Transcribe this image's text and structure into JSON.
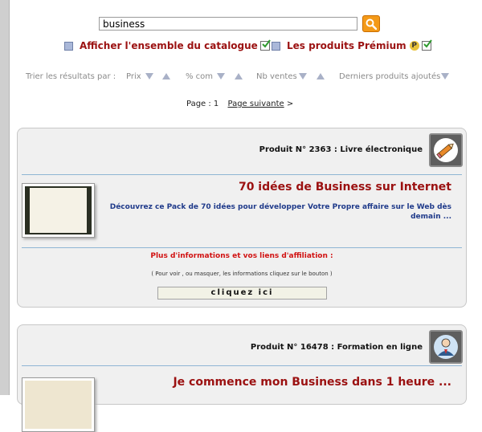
{
  "search": {
    "value": "business"
  },
  "filters": {
    "catalogue_label": "Afficher l'ensemble du catalogue",
    "premium_label": "Les produits Prémium",
    "premium_badge": "P"
  },
  "sort": {
    "label": "Trier les résultats par :",
    "options": [
      "Prix",
      "% com",
      "Nb ventes",
      "Derniers produits ajoutés"
    ]
  },
  "pager": {
    "page_label": "Page : 1",
    "next_label": "Page suivante",
    "next_arrow": ">"
  },
  "products": [
    {
      "header": "Produit N° 2363 : Livre électronique",
      "type_icon": "pencil-icon",
      "title": "70 idées de Business sur Internet",
      "description": "Découvrez ce Pack de 70 idées pour développer Votre Propre affaire sur le Web dès demain ...",
      "more_info": "Plus d'informations et vos liens d'affiliation :",
      "hint": "( Pour voir , ou masquer, les informations cliquez sur le bouton )",
      "button": "cliquez ici"
    },
    {
      "header": "Produit N° 16478 : Formation en ligne",
      "type_icon": "user-icon",
      "title": "Je commence mon Business dans 1 heure ..."
    }
  ],
  "colors": {
    "accent_red": "#9b1111",
    "link_blue": "#1f3a8a",
    "search_orange": "#f49a18",
    "divider_blue": "#8fb5d4"
  }
}
